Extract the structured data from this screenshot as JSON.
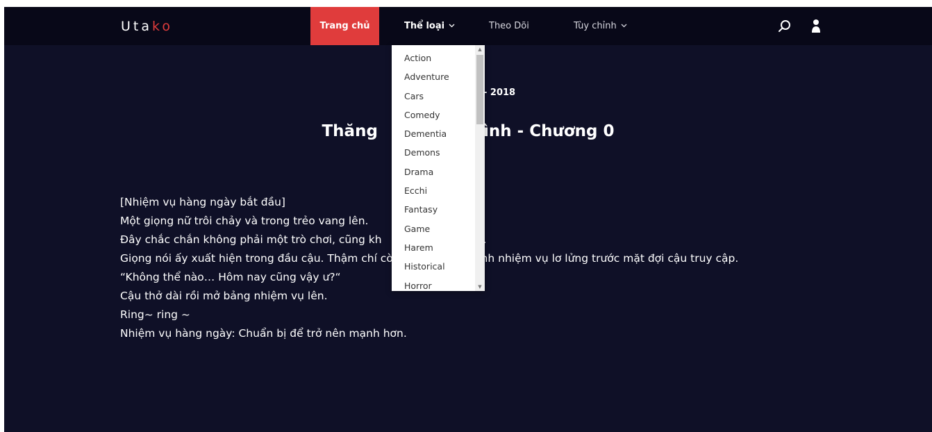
{
  "header": {
    "logo_main": "Uta",
    "logo_accent": "ko",
    "nav": {
      "home": "Trang chủ",
      "genre": "Thể loại",
      "follow": "Theo Dõi",
      "custom": "Tùy chỉnh"
    }
  },
  "genre_dropdown": {
    "items": [
      "Action",
      "Adventure",
      "Cars",
      "Comedy",
      "Dementia",
      "Demons",
      "Drama",
      "Ecchi",
      "Fantasy",
      "Game",
      "Harem",
      "Historical",
      "Horror"
    ]
  },
  "chapter": {
    "date_fragment": "- 2018",
    "title": "Thăng                   ình - Chương 0",
    "paragraphs": [
      "[Nhiệm vụ hàng ngày bắt đầu]",
      "Một giọng nữ trôi chảy và trong trẻo vang lên.",
      "Đây chắc chắn không phải một trò chơi, cũng kh                    ấc mơ.",
      "Giọng nói ấy xuất hiện trong đầu cậu. Thậm chí còn có một màn hình nhiệm vụ lơ lửng trước mặt đợi cậu truy cập.",
      "“Không thể nào… Hôm nay cũng vậy ư?“",
      "Cậu thở dài rồi mở bảng nhiệm vụ lên.",
      "Ring~ ring ~",
      "Nhiệm vụ hàng ngày: Chuẩn bị để trở nên mạnh hơn."
    ]
  },
  "icons": {
    "search": "search-icon",
    "user": "user-icon"
  },
  "colors": {
    "background": "#0f1027",
    "header": "#080818",
    "accent": "#e03c3c"
  }
}
